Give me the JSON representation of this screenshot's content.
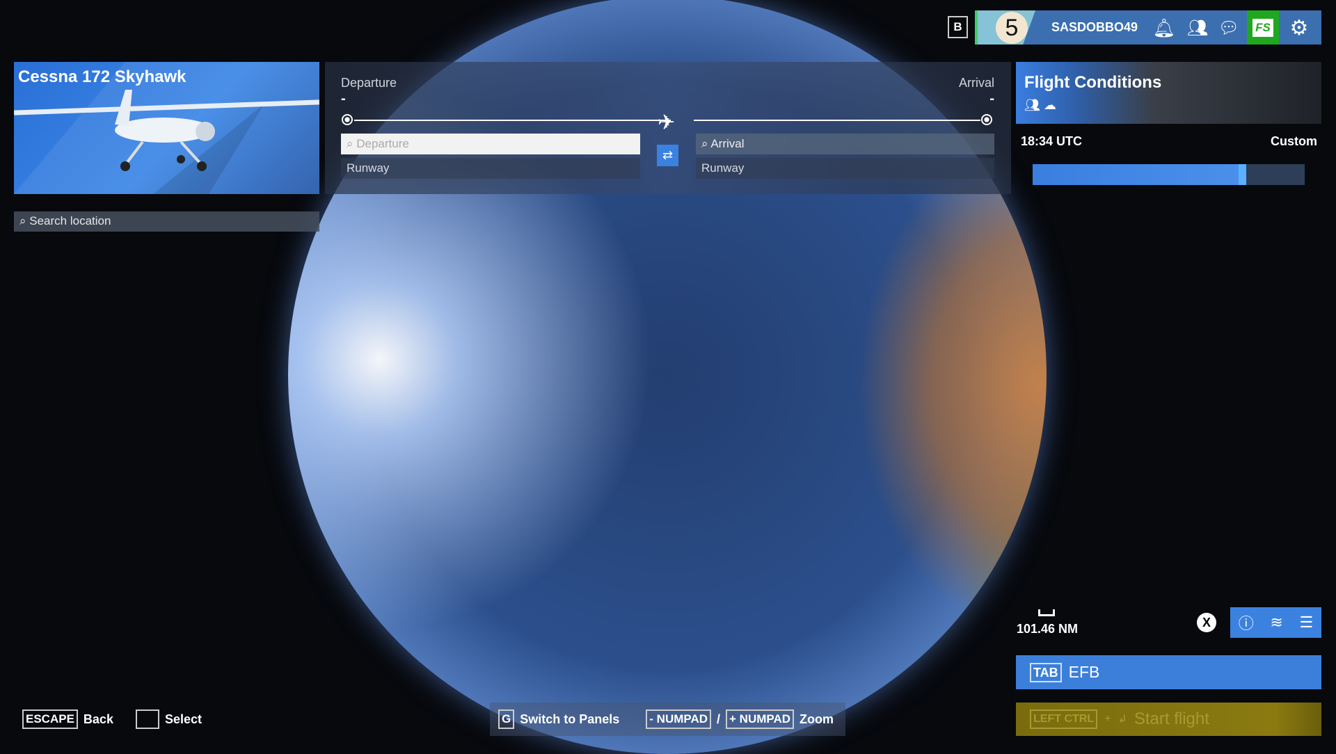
{
  "aircraft": {
    "name": "Cessna 172 Skyhawk"
  },
  "search": {
    "placeholder": "Search location"
  },
  "route": {
    "departure_label": "Departure",
    "arrival_label": "Arrival",
    "departure_value": "-",
    "arrival_value": "-",
    "departure_placeholder": "Departure",
    "arrival_placeholder": "Arrival",
    "departure_runway": "Runway",
    "arrival_runway": "Runway"
  },
  "topbar": {
    "b_key": "B",
    "level": "5",
    "username": "SASDOBBO49",
    "store_label": "FS"
  },
  "conditions": {
    "title": "Flight Conditions",
    "time": "18:34 UTC",
    "preset": "Custom",
    "time_slider_percent": 77
  },
  "map": {
    "scale": "101.46 NM",
    "close_key": "X"
  },
  "efb": {
    "key": "TAB",
    "label": "EFB"
  },
  "start": {
    "key": "LEFT CTRL",
    "plus": "+",
    "label": "Start flight"
  },
  "footer": {
    "escape_key": "ESCAPE",
    "back": "Back",
    "select": "Select",
    "g_key": "G",
    "switch": "Switch to Panels",
    "minus_key": "- NUMPAD",
    "slash": "/",
    "plus_key": "+ NUMPAD",
    "zoom": "Zoom"
  },
  "colors": {
    "accent": "#3b82e0",
    "store": "#1fa81f",
    "start": "#8a7a10"
  }
}
